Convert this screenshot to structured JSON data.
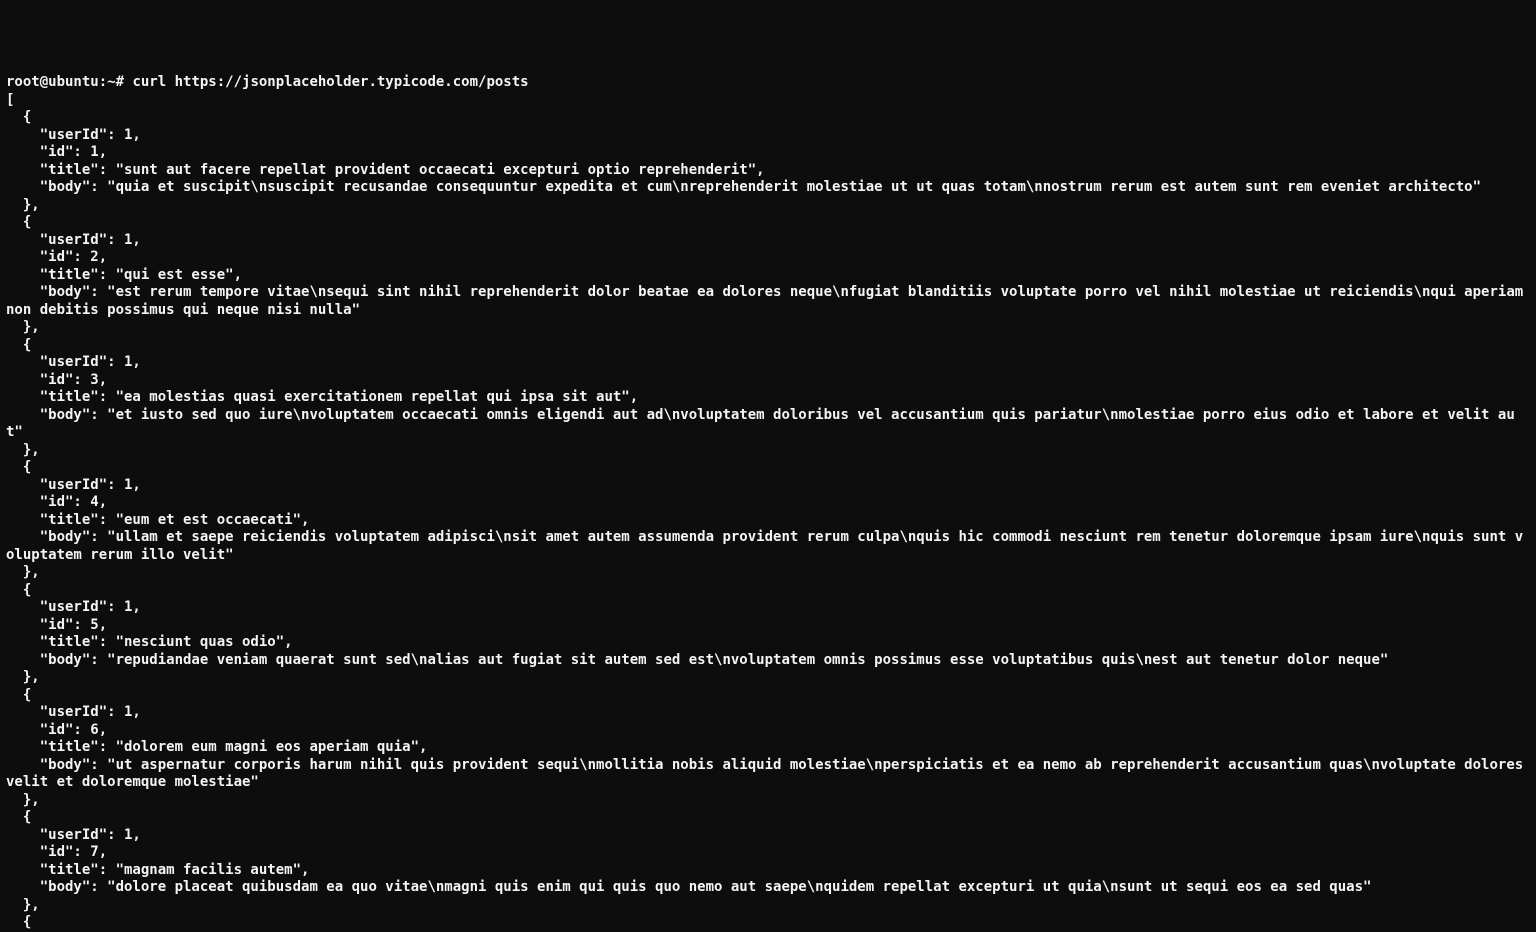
{
  "terminal": {
    "prompt": "root@ubuntu:~# ",
    "command": "curl https://jsonplaceholder.typicode.com/posts",
    "output_open": "[",
    "posts": [
      {
        "userId": 1,
        "id": 1,
        "title": "sunt aut facere repellat provident occaecati excepturi optio reprehenderit",
        "body": "quia et suscipit\\nsuscipit recusandae consequuntur expedita et cum\\nreprehenderit molestiae ut ut quas totam\\nnostrum rerum est autem sunt rem eveniet architecto"
      },
      {
        "userId": 1,
        "id": 2,
        "title": "qui est esse",
        "body": "est rerum tempore vitae\\nsequi sint nihil reprehenderit dolor beatae ea dolores neque\\nfugiat blanditiis voluptate porro vel nihil molestiae ut reiciendis\\nqui aperiam non debitis possimus qui neque nisi nulla"
      },
      {
        "userId": 1,
        "id": 3,
        "title": "ea molestias quasi exercitationem repellat qui ipsa sit aut",
        "body": "et iusto sed quo iure\\nvoluptatem occaecati omnis eligendi aut ad\\nvoluptatem doloribus vel accusantium quis pariatur\\nmolestiae porro eius odio et labore et velit aut"
      },
      {
        "userId": 1,
        "id": 4,
        "title": "eum et est occaecati",
        "body": "ullam et saepe reiciendis voluptatem adipisci\\nsit amet autem assumenda provident rerum culpa\\nquis hic commodi nesciunt rem tenetur doloremque ipsam iure\\nquis sunt voluptatem rerum illo velit"
      },
      {
        "userId": 1,
        "id": 5,
        "title": "nesciunt quas odio",
        "body": "repudiandae veniam quaerat sunt sed\\nalias aut fugiat sit autem sed est\\nvoluptatem omnis possimus esse voluptatibus quis\\nest aut tenetur dolor neque"
      },
      {
        "userId": 1,
        "id": 6,
        "title": "dolorem eum magni eos aperiam quia",
        "body": "ut aspernatur corporis harum nihil quis provident sequi\\nmollitia nobis aliquid molestiae\\nperspiciatis et ea nemo ab reprehenderit accusantium quas\\nvoluptate dolores velit et doloremque molestiae"
      },
      {
        "userId": 1,
        "id": 7,
        "title": "magnam facilis autem",
        "body": "dolore placeat quibusdam ea quo vitae\\nmagni quis enim qui quis quo nemo aut saepe\\nquidem repellat excepturi ut quia\\nsunt ut sequi eos ea sed quas"
      }
    ],
    "trailing_open": "  {"
  }
}
